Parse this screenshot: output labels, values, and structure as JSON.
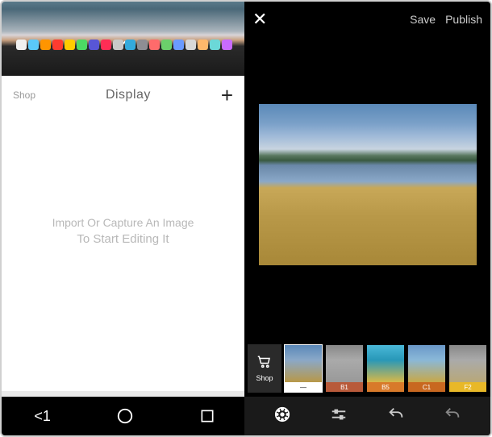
{
  "left": {
    "shop": "Shop",
    "display": "Display",
    "plus": "+",
    "chevron": "⌄",
    "msg_line1": "Import Or Capture An Image",
    "msg_line2": "To Start Editing It",
    "nav_back": "<1"
  },
  "right": {
    "close": "✕",
    "save": "Save",
    "publish": "Publish",
    "shop_btn": "Shop",
    "filters": [
      {
        "label": "—",
        "bg": "#fff",
        "img": "linear-gradient(to bottom,#5a88b8 0%,#8aa8c8 40%,#b89848 100%)"
      },
      {
        "label": "B1",
        "bg": "#b85a3a",
        "img": "linear-gradient(to bottom,#888 0%,#aaa 40%,#999 100%)"
      },
      {
        "label": "B5",
        "bg": "#d87a2a",
        "img": "linear-gradient(to bottom,#4ab8d8 0%,#2898b8 40%,#d8b848 100%)"
      },
      {
        "label": "C1",
        "bg": "#c86820",
        "img": "linear-gradient(to bottom,#6a98c8 0%,#8ab8d8 40%,#c8a848 100%)"
      },
      {
        "label": "F2",
        "bg": "#e8b828",
        "img": "linear-gradient(to bottom,#888 0%,#aaa 40%,#b8a878 100%)"
      }
    ]
  },
  "dock_colors": [
    "#f0f0f0",
    "#5ac8fa",
    "#ff9500",
    "#ff3b30",
    "#ffcc00",
    "#4cd964",
    "#5856d6",
    "#ff2d55",
    "#c8c8c8",
    "#34aadc",
    "#8e8e93",
    "#ff6b6b",
    "#6bcf6b",
    "#6b9bff",
    "#d8d8d8",
    "#ffb86b",
    "#6bd8d8",
    "#c86bff"
  ]
}
